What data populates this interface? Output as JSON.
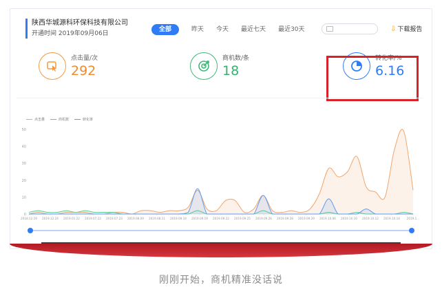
{
  "header": {
    "company_name": "陕西华城源科环保科技有限公司",
    "open_date": "开通时间 2019年09月06日",
    "tabs": [
      "全部",
      "昨天",
      "今天",
      "最近七天",
      "最近30天"
    ],
    "active_tab": "全部",
    "download_label": "下载报告"
  },
  "metrics": [
    {
      "label": "点击量/次",
      "value": "292",
      "icon": "click-icon",
      "color": "#f08a2a"
    },
    {
      "label": "商机数/条",
      "value": "18",
      "icon": "target-icon",
      "color": "#35b16e"
    },
    {
      "label": "转化率/%",
      "value": "6.16",
      "icon": "pie-icon",
      "color": "#2f7cf6"
    }
  ],
  "chart_data": {
    "type": "line",
    "legend": [
      "点击量",
      "商机数",
      "转化率"
    ],
    "colors": [
      "#f2a56b",
      "#5cc88f",
      "#5a9bf5"
    ],
    "x": [
      "2018.12.19",
      "2019.12.24",
      "2019.01.22",
      "2019.07.22",
      "2019.07.23",
      "2019.08.09",
      "2019.08.11",
      "2019.09.19",
      "2019.09.19",
      "2019.09.22",
      "2019.09.25",
      "2019.09.26",
      "2019.09.28",
      "2019.09.29",
      "2019.10.06",
      "2019.10.10",
      "2019.10.12",
      "2019.10.14",
      "2019.1..."
    ],
    "yticks": [
      0,
      10,
      20,
      30,
      40,
      50
    ],
    "ylim": [
      0,
      50
    ],
    "series": [
      {
        "name": "点击量",
        "values": [
          0,
          1,
          0,
          0,
          1,
          1,
          1,
          0,
          0,
          1,
          1,
          0,
          2,
          2,
          1,
          2,
          2,
          4,
          14,
          3,
          2,
          8,
          8,
          1,
          3,
          11,
          2,
          1,
          2,
          1,
          3,
          12,
          27,
          22,
          25,
          34,
          16,
          13,
          10,
          38,
          49,
          14
        ]
      },
      {
        "name": "商机数",
        "values": [
          1,
          2,
          1,
          1,
          2,
          1,
          2,
          1,
          1,
          1,
          0,
          0,
          0,
          0,
          0,
          0,
          0,
          0,
          2,
          0,
          0,
          0,
          0,
          0,
          0,
          2,
          0,
          0,
          0,
          0,
          0,
          0,
          1,
          0,
          0,
          1,
          0,
          0,
          0,
          0,
          1,
          0
        ]
      },
      {
        "name": "转化率",
        "values": [
          0,
          0,
          0,
          0,
          0,
          0,
          0,
          0,
          0,
          0,
          0,
          0,
          0,
          0,
          0,
          0,
          0,
          1,
          15,
          0,
          0,
          0,
          0,
          0,
          0,
          11,
          0,
          0,
          0,
          0,
          0,
          0,
          9,
          0,
          0,
          0,
          3,
          0,
          0,
          0,
          0,
          0
        ]
      }
    ]
  },
  "caption": "刚刚开始，商机精准没话说"
}
